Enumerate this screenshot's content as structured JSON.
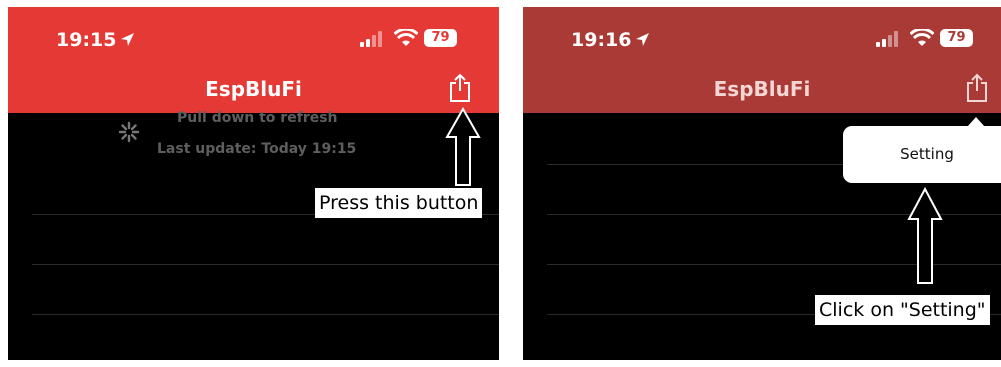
{
  "left": {
    "time": "19:15",
    "battery": "79",
    "title": "EspBluFi",
    "pull_text": "Pull down to refresh",
    "last_update": "Last update: Today 19:15",
    "callout": "Press this button",
    "icons": [
      "location-arrow-icon",
      "signal-icon",
      "wifi-icon",
      "battery-icon",
      "share-icon",
      "spinner-icon"
    ]
  },
  "right": {
    "time": "19:16",
    "battery": "79",
    "title": "EspBluFi",
    "menu_item": "Setting",
    "callout": "Click on \"Setting\"",
    "icons": [
      "location-arrow-icon",
      "signal-icon",
      "wifi-icon",
      "battery-icon",
      "share-icon"
    ]
  },
  "colors": {
    "left_bar": "#e53935",
    "right_bar": "#aa3a36",
    "background": "#000000"
  }
}
